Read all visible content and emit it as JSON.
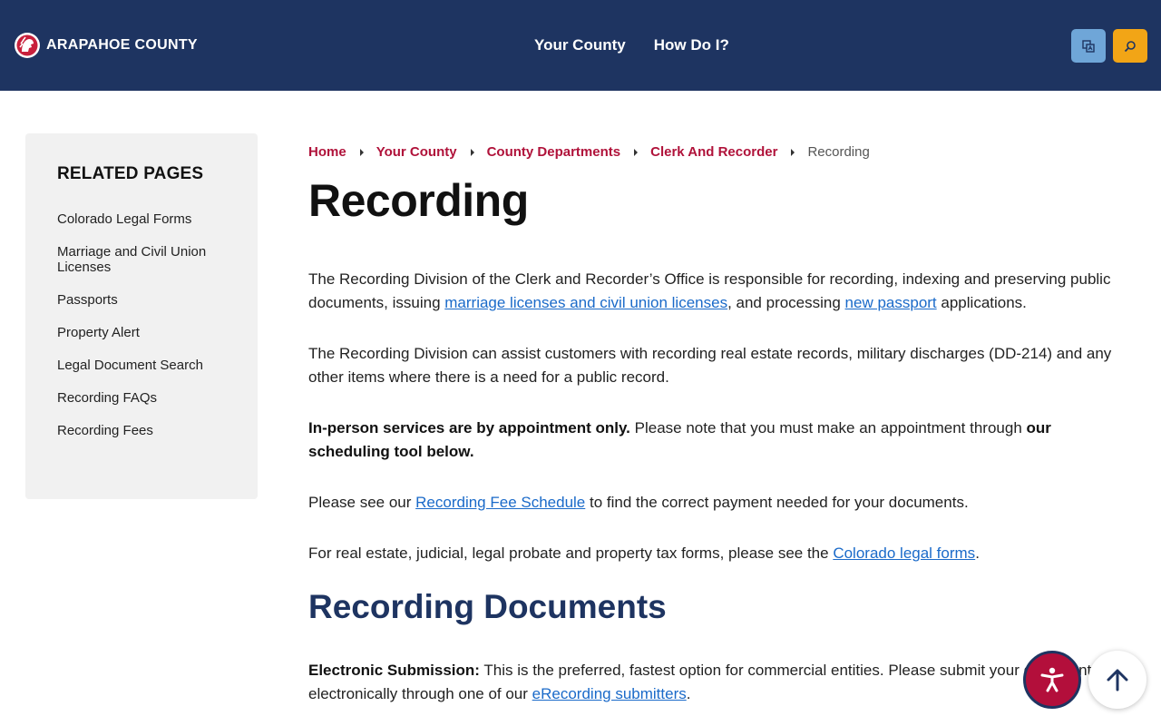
{
  "header": {
    "logo_text": "ARAPAHOE COUNTY",
    "nav": [
      "Your County",
      "How Do I?"
    ],
    "translate_icon": "translate-icon",
    "search_icon": "search-icon"
  },
  "sidebar": {
    "heading": "RELATED PAGES",
    "items": [
      "Colorado Legal Forms",
      "Marriage and Civil Union Licenses",
      "Passports",
      "Property Alert",
      "Legal Document Search",
      "Recording FAQs",
      "Recording Fees"
    ]
  },
  "breadcrumb": {
    "links": [
      "Home",
      "Your County",
      "County Departments",
      "Clerk And Recorder"
    ],
    "current": "Recording"
  },
  "page_title": "Recording",
  "content": {
    "p1_before": "The Recording Division of the Clerk and Recorder’s Office is responsible for recording, indexing and preserving public documents, issuing ",
    "p1_link1": "marriage licenses and civil union licenses",
    "p1_mid": ", and processing ",
    "p1_link2": "new passport",
    "p1_after": " applications.",
    "p2": "The Recording Division can assist customers with recording real estate records, military discharges (DD-214) and any other items where there is a need for a public record.",
    "p3_bold1": "In-person services are by appointment only.",
    "p3_mid": " Please note that you must make an appointment through ",
    "p3_bold2": "our scheduling tool below.",
    "p4_before": "Please see our ",
    "p4_link": "Recording Fee Schedule",
    "p4_after": " to find the correct payment needed for your documents.",
    "p5_before": "For real estate, judicial, legal probate and property tax forms, please see the ",
    "p5_link": "Colorado legal forms",
    "p5_after": ".",
    "section_title": "Recording Documents",
    "p6_bold": "Electronic Submission:",
    "p6_mid": " This is the preferred, fastest option for commercial entities. Please submit your documents electronically through one of our ",
    "p6_link": "eRecording submitters",
    "p6_after": "."
  },
  "floating": {
    "accessibility_icon": "accessibility-icon",
    "back_to_top_icon": "arrow-up-icon"
  },
  "colors": {
    "header_bg": "#1e3461",
    "breadcrumb_link": "#b0123a",
    "link": "#1a6ac9",
    "section_title": "#1e3461",
    "search_btn": "#f2a516",
    "translate_btn": "#6fa6d8",
    "accessibility_btn": "#b30f3b"
  }
}
